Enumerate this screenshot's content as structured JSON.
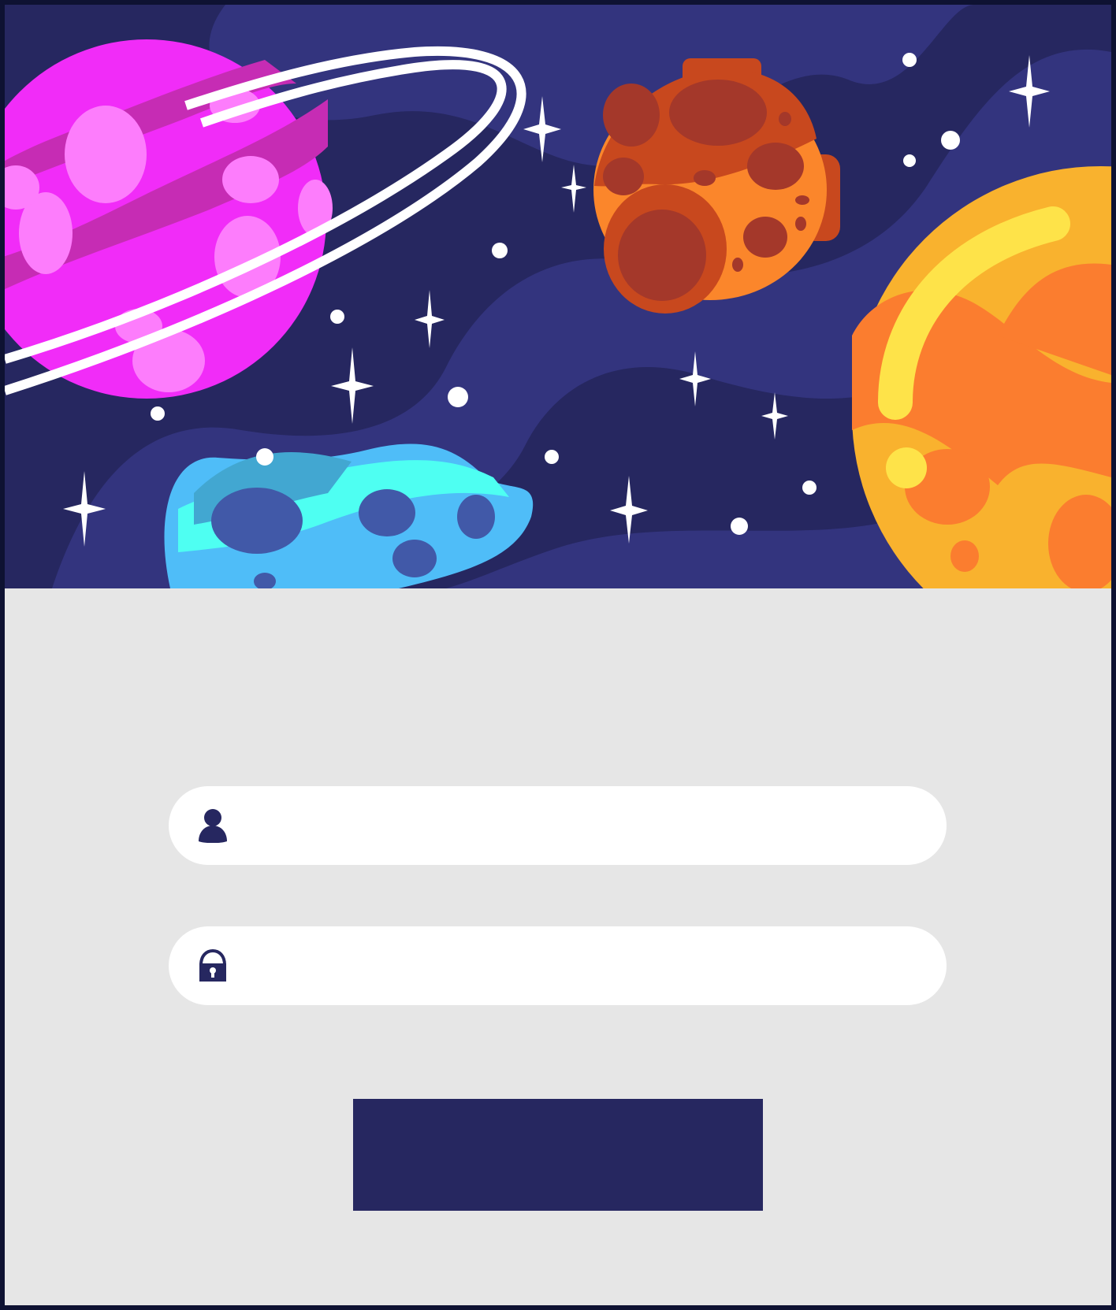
{
  "login": {
    "username_value": "",
    "username_placeholder": "",
    "password_value": "",
    "password_placeholder": "",
    "submit_label": ""
  },
  "icons": {
    "username": "user-icon",
    "password": "lock-icon"
  },
  "colors": {
    "frame_border": "#0e1232",
    "space_background": "#262760",
    "form_background": "#e6e6e6",
    "field_background": "#ffffff",
    "icon_color": "#262760",
    "button_background": "#262760"
  }
}
